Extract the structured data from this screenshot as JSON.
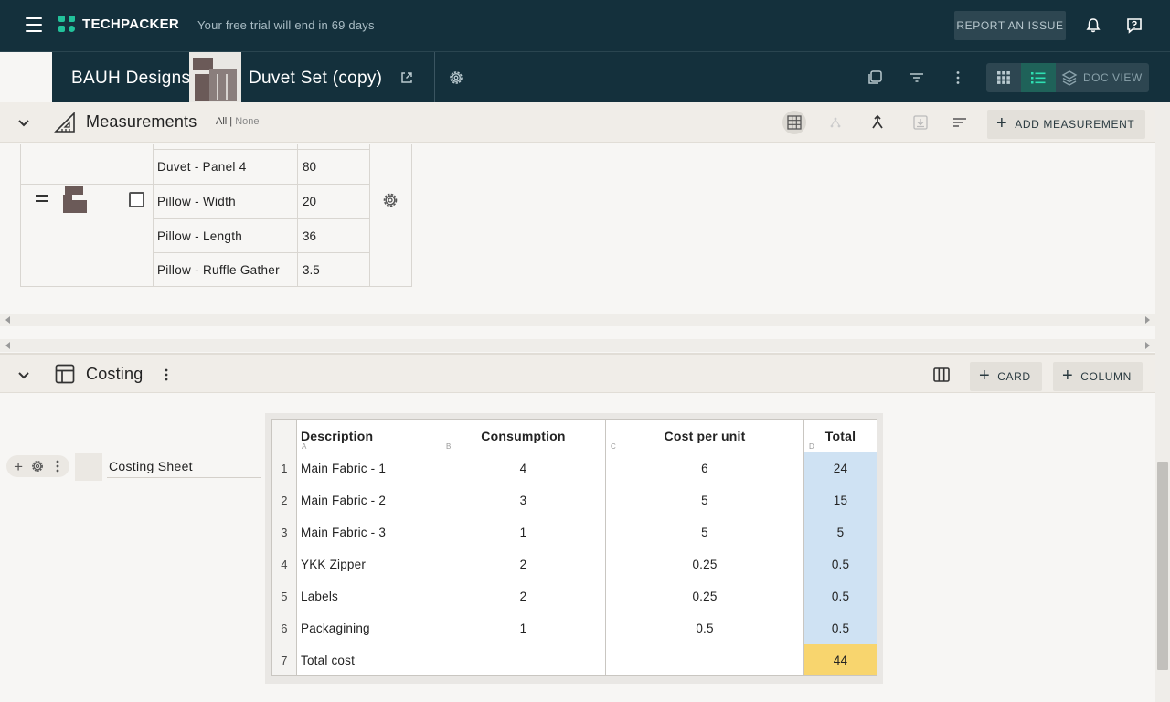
{
  "topbar": {
    "logo_text": "TECHPACKER",
    "trial_text": "Your free trial will end in 69 days",
    "report_label": "REPORT AN ISSUE",
    "icons": [
      "menu-icon",
      "bell-icon",
      "help-chat-icon"
    ]
  },
  "product": {
    "brand": "BAUH Designs",
    "name": "Duvet Set (copy)",
    "view_doc_label": "DOC VIEW"
  },
  "measurements": {
    "title": "Measurements",
    "select_all": "All",
    "separator": " | ",
    "select_none": "None",
    "add_label": "ADD MEASUREMENT",
    "rows": [
      {
        "name": "Duvet - Panel 4",
        "value": "80"
      },
      {
        "name": "Pillow - Width",
        "value": "20"
      },
      {
        "name": "Pillow - Length",
        "value": "36"
      },
      {
        "name": "Pillow - Ruffle Gather",
        "value": "3.5"
      }
    ]
  },
  "costing": {
    "title": "Costing",
    "card_label": "CARD",
    "column_label": "COLUMN",
    "card_title": "Costing Sheet",
    "sheet": {
      "headers": [
        {
          "label": "Description",
          "letter": "A"
        },
        {
          "label": "Consumption",
          "letter": "B"
        },
        {
          "label": "Cost per unit",
          "letter": "C"
        },
        {
          "label": "Total",
          "letter": "D"
        }
      ],
      "rows": [
        {
          "n": "1",
          "desc": "Main Fabric  - 1",
          "cons": "4",
          "cpu": "6",
          "total": "24"
        },
        {
          "n": "2",
          "desc": "Main Fabric - 2",
          "cons": "3",
          "cpu": "5",
          "total": "15"
        },
        {
          "n": "3",
          "desc": "Main Fabric - 3",
          "cons": "1",
          "cpu": "5",
          "total": "5"
        },
        {
          "n": "4",
          "desc": "YKK Zipper",
          "cons": "2",
          "cpu": "0.25",
          "total": "0.5"
        },
        {
          "n": "5",
          "desc": "Labels",
          "cons": "2",
          "cpu": "0.25",
          "total": "0.5"
        },
        {
          "n": "6",
          "desc": "Packagining",
          "cons": "1",
          "cpu": "0.5",
          "total": "0.5"
        },
        {
          "n": "7",
          "desc": "Total cost",
          "cons": "",
          "cpu": "",
          "total": "44"
        }
      ]
    }
  },
  "colors": {
    "topbar": "#14303c",
    "accent": "#22c29b",
    "total_cell": "#cfe2f3",
    "grand_total_cell": "#f8d56e"
  }
}
